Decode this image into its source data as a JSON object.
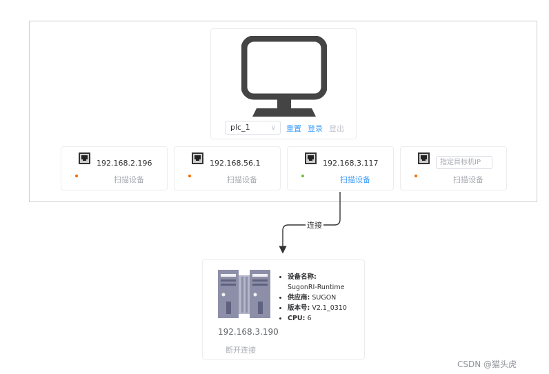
{
  "device": {
    "plc_select_value": "plc_1",
    "reset_label": "重置",
    "login_label": "登录",
    "logout_label": "登出"
  },
  "nics": [
    {
      "ip": "192.168.2.196",
      "status_color": "#f56c00",
      "scan_label": "扫描设备"
    },
    {
      "ip": "192.168.56.1",
      "status_color": "#f56c00",
      "scan_label": "扫描设备"
    },
    {
      "ip": "192.168.3.117",
      "status_color": "#67c23a",
      "scan_label": "扫描设备"
    },
    {
      "ip_placeholder": "指定目标机IP",
      "status_color": "#f56c00",
      "scan_label": "扫描设备"
    }
  ],
  "connection": {
    "label": "连接"
  },
  "runtime": {
    "ip": "192.168.3.190",
    "disconnect_label": "断开连接",
    "info": {
      "name_key": "设备名称:",
      "name_value": "SugonRI-Runtime",
      "vendor_key": "供应商:",
      "vendor_value": "SUGON",
      "version_key": "版本号:",
      "version_value": "V2.1_0310",
      "cpu_key": "CPU:",
      "cpu_value": "6"
    }
  },
  "watermark": "CSDN @猫头虎",
  "colors": {
    "accent": "#409eff",
    "online": "#67c23a",
    "offline": "#f56c00"
  }
}
